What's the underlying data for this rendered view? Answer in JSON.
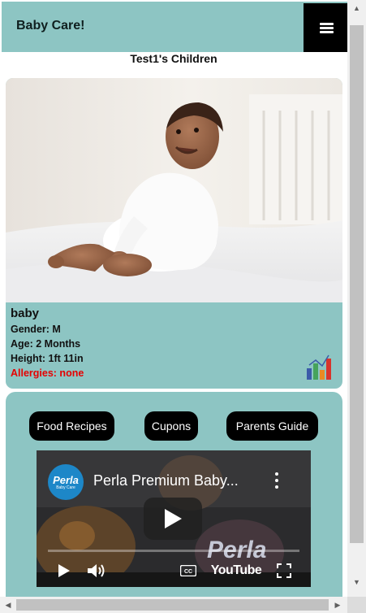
{
  "header": {
    "brand": "Baby Care!",
    "menu_icon": "hamburger-menu-icon"
  },
  "page": {
    "title": "Test1's Children"
  },
  "child": {
    "name": "baby",
    "gender": "Gender: M",
    "age": "Age: 2 Months",
    "height": "Height: 1ft 11in",
    "allergies": "Allergies: none",
    "stats_icon": "bar-chart-icon"
  },
  "links": {
    "recipes": "Food Recipes",
    "cupons": "Cupons",
    "guide": "Parents Guide"
  },
  "video": {
    "title": "Perla Premium Baby...",
    "channel_logo": "Perla",
    "channel_logo_sub": "Baby Care",
    "watermark": "Perla",
    "platform": "YouTube",
    "progress": 0
  },
  "colors": {
    "accent": "#8dc5c3",
    "button": "#000000",
    "allergy": "#e60000"
  }
}
